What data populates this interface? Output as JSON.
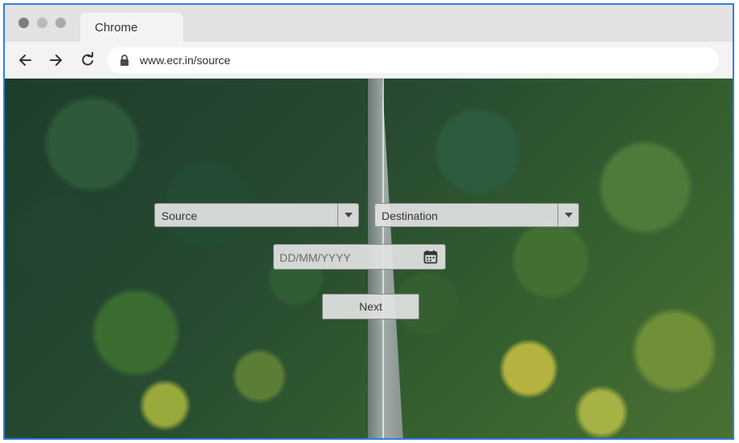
{
  "browser": {
    "tab_title": "Chrome",
    "url": "www.ecr.in/source",
    "accent_color": "#2f7fd8",
    "icons": [
      "back-arrow-icon",
      "forward-arrow-icon",
      "reload-icon",
      "lock-icon"
    ]
  },
  "form": {
    "source_label": "Source",
    "destination_label": "Destination",
    "date_placeholder": "DD/MM/YYYY",
    "next_label": "Next",
    "icons": [
      "chevron-down-icon",
      "calendar-icon"
    ]
  }
}
